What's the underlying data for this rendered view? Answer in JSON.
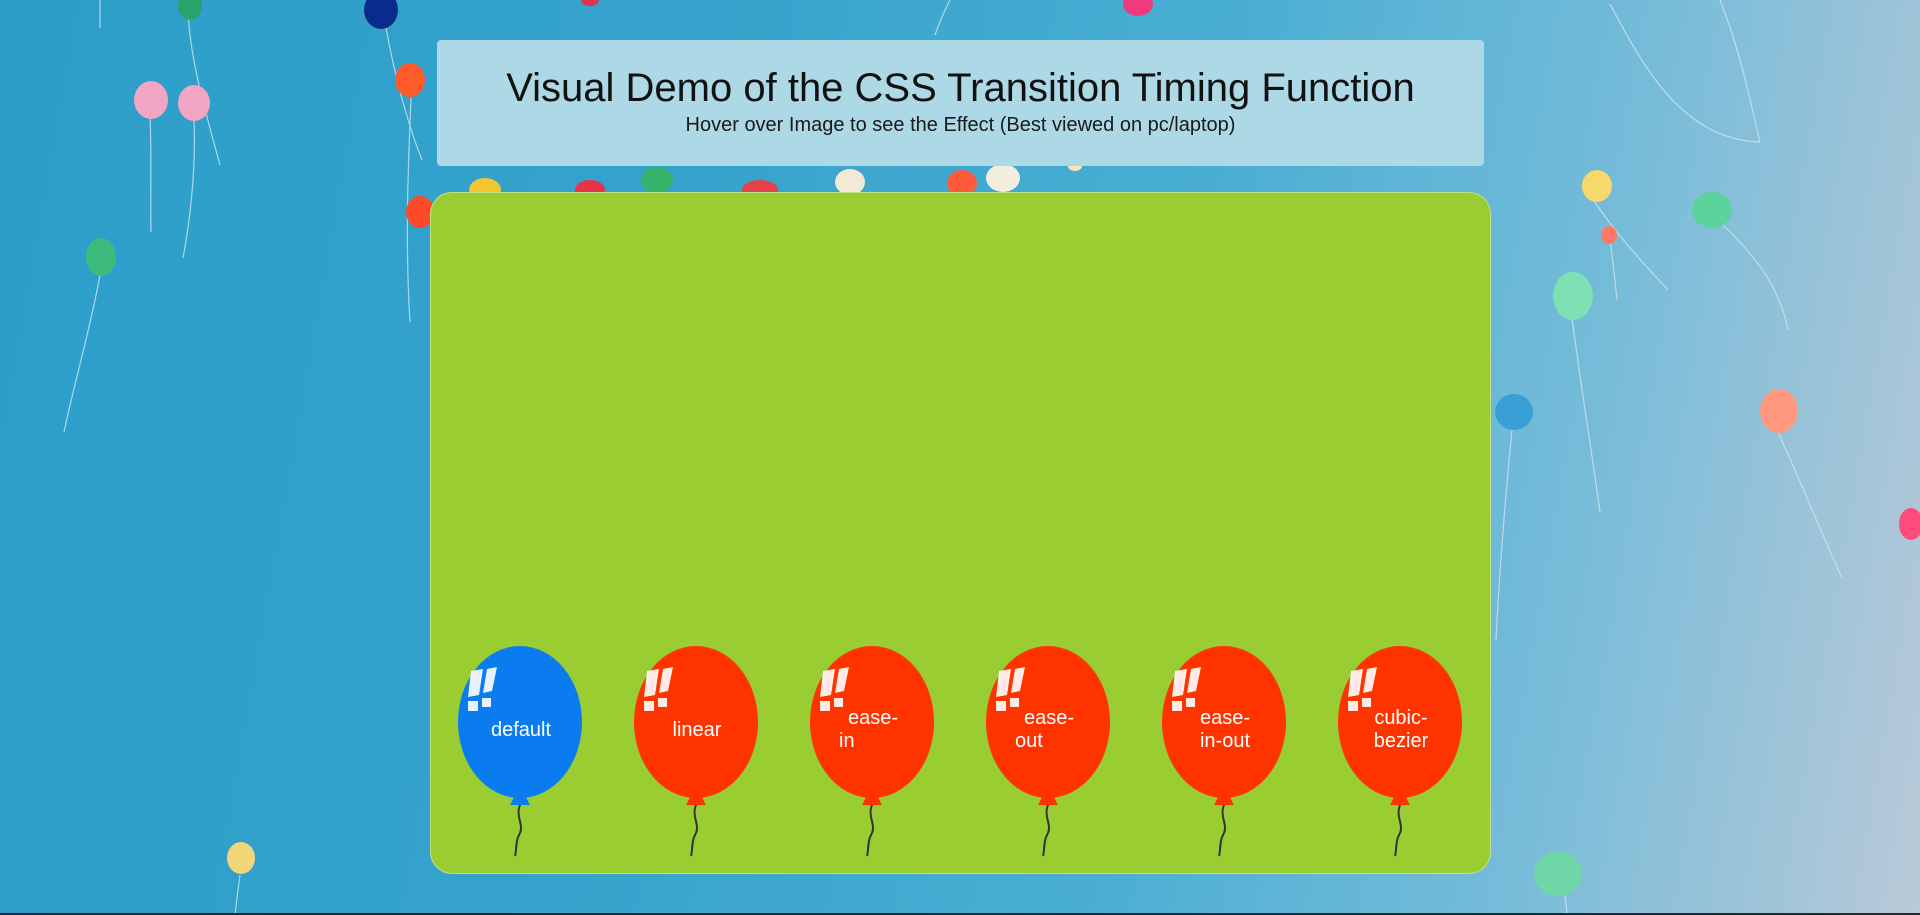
{
  "header": {
    "title": "Visual Demo of the CSS Transition Timing Function",
    "subtitle": "Hover over Image to see the Effect (Best viewed on pc/laptop)"
  },
  "colors": {
    "stage": "#9acd32",
    "header": "#add8e6",
    "balloon_default": "#0a7cf0",
    "balloon_other": "#ff3300",
    "sky": "#2b9ec9"
  },
  "balloons": [
    {
      "label_line1": "default",
      "label_line2": "",
      "timing": "default",
      "color": "#0a7cf0"
    },
    {
      "label_line1": "linear",
      "label_line2": "",
      "timing": "linear",
      "color": "#ff3300"
    },
    {
      "label_line1": "ease-",
      "label_line2": "in",
      "timing": "ease-in",
      "color": "#ff3300"
    },
    {
      "label_line1": "ease-",
      "label_line2": "out",
      "timing": "ease-out",
      "color": "#ff3300"
    },
    {
      "label_line1": "ease-",
      "label_line2": "in-out",
      "timing": "ease-in-out",
      "color": "#ff3300"
    },
    {
      "label_line1": "cubic-",
      "label_line2": "bezier",
      "timing": "cubic-bezier",
      "color": "#ff3300"
    }
  ]
}
